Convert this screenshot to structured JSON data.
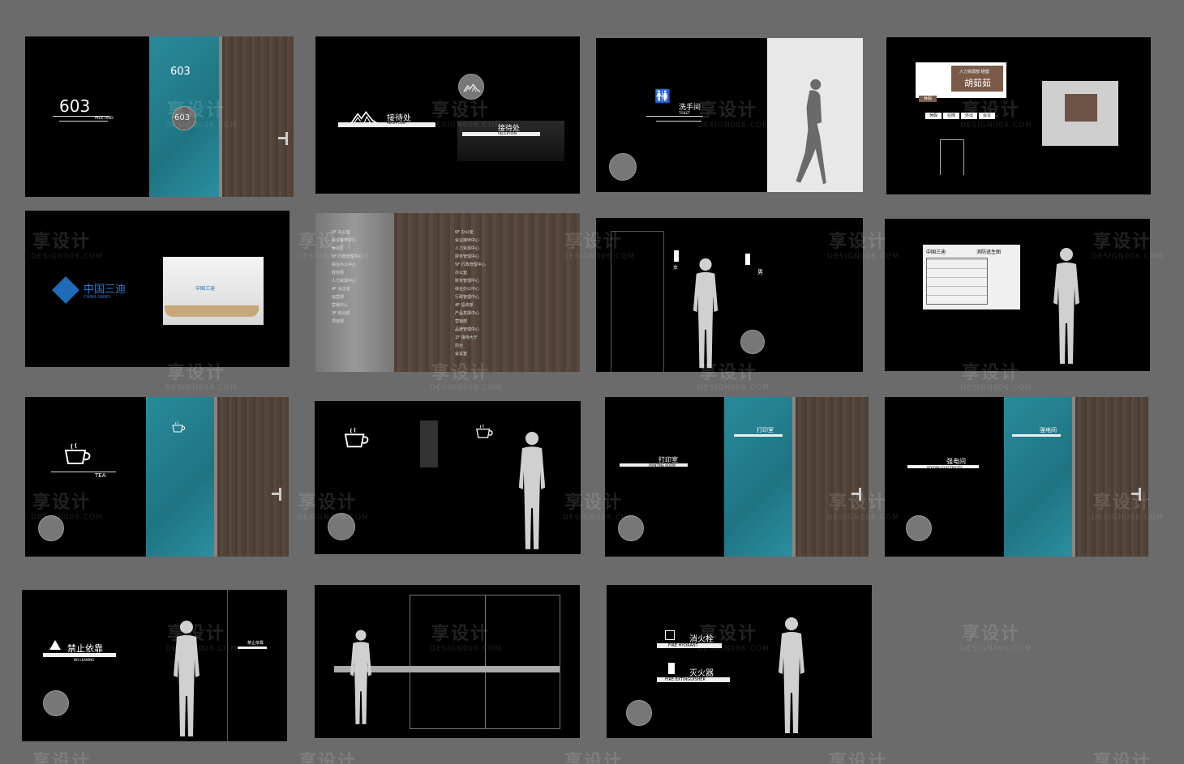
{
  "watermark": {
    "text": "享设计",
    "sub": "DESIGN006.COM"
  },
  "panel1": {
    "room_large": "603",
    "meeting": "MEETING",
    "room_teal": "603",
    "room_circle": "603"
  },
  "panel2": {
    "title": "接待处",
    "sub": "RECEPTION",
    "title2": "接待处",
    "sub2": "RECEPTION"
  },
  "panel3": {
    "title": "洗手间",
    "sub": "TOILET"
  },
  "panel4": {
    "name": "胡茹茹",
    "role": "人力资源部 经理",
    "status": "休假",
    "tabs": [
      "休假",
      "在岗",
      "外出",
      "会议"
    ]
  },
  "panel5": {
    "logo_cn": "中国三迪",
    "logo_en": "CHINA SANDI"
  },
  "panel6": {
    "left": [
      "6F 办公室",
      "会议接待中心",
      "休闲区",
      "5F 行政管理中心",
      "综合办公中心",
      "财务部",
      "人力资源中心",
      "4F 会议室",
      "运营部",
      "营销中心",
      "3F 综合部",
      "项目部"
    ],
    "right": [
      "6F 办公室",
      "会议接待中心",
      "人力资源中心",
      "财务管理中心",
      "5F 行政管理中心",
      "办公室",
      "财务管理中心",
      "综合办公中心",
      "行政管理中心",
      "4F 投资部",
      "产品发展中心",
      "营销部",
      "品牌管理中心",
      "1F 接待大厅",
      "前台",
      "会议室"
    ]
  },
  "panel7": {
    "female": "女",
    "male": "男"
  },
  "panel8": {
    "logo": "中国三迪",
    "title": "消防逃生图"
  },
  "panel9": {
    "label": "TEA"
  },
  "panel11": {
    "title": "打印室",
    "sub": "PRINTING ROOM",
    "teal_title": "打印室",
    "teal_sub": "PRINTING ROOM"
  },
  "panel12": {
    "title": "强电间",
    "sub": "STRONG ELECTRICITY",
    "teal_title": "强电间",
    "teal_sub": "STRONG ELECTRICITY"
  },
  "panel13": {
    "title": "禁止依靠",
    "sub": "NO LEANING",
    "small_sign": "禁止依靠"
  },
  "panel15": {
    "hydrant": "消火栓",
    "hydrant_en": "FIRE HYDRANT",
    "ext": "灭火器",
    "ext_en": "FIRE EXTINGUISHER"
  }
}
